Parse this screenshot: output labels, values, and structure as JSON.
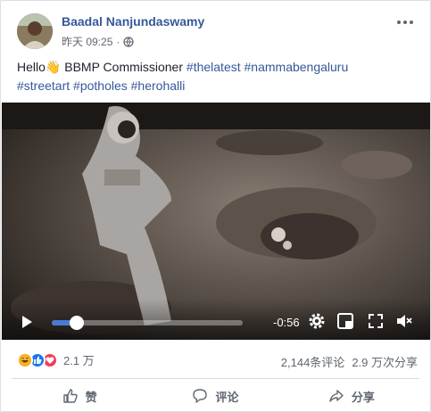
{
  "post": {
    "author": "Baadal Nanjundaswamy",
    "timestamp": "昨天 09:25",
    "privacy_icon": "globe-icon",
    "text_lead": "Hello",
    "text_emoji": "👋",
    "text_body": " BBMP Commissioner ",
    "hashtags": [
      "#thelatest",
      "#nammabengaluru",
      "#streetart",
      "#potholes",
      "#herohalli"
    ]
  },
  "video": {
    "progress": 0.13,
    "time_remaining": "-0:56",
    "controls": [
      "play-icon",
      "gear-icon",
      "pip-icon",
      "fullscreen-icon",
      "volume-mute-icon"
    ]
  },
  "stats": {
    "reactions": [
      "haha",
      "like",
      "love"
    ],
    "reaction_count": "2.1 万",
    "comments": "2,144条评论",
    "shares": "2.9 万次分享"
  },
  "actions": {
    "like_label": "赞",
    "comment_label": "评论",
    "share_label": "分享"
  },
  "colors": {
    "link": "#365899",
    "progress": "#4b7ad5",
    "like": "#1877f2",
    "love": "#f33e58",
    "haha": "#f7b125"
  }
}
